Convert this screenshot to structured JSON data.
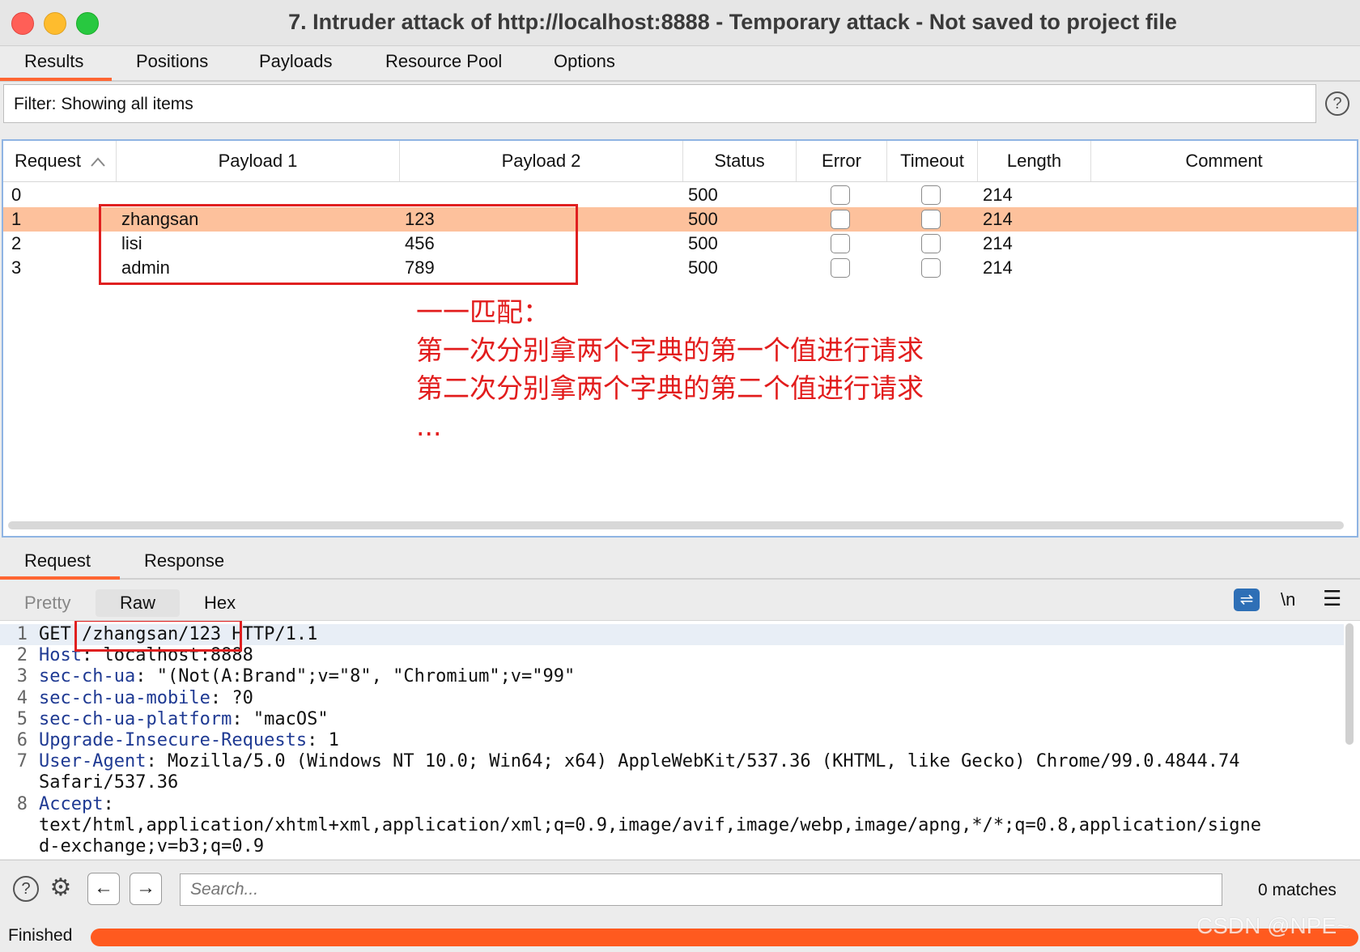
{
  "window": {
    "title": "7. Intruder attack of http://localhost:8888 - Temporary attack - Not saved to project file"
  },
  "tabs": [
    "Results",
    "Positions",
    "Payloads",
    "Resource Pool",
    "Options"
  ],
  "filter": {
    "text": "Filter: Showing all items"
  },
  "table": {
    "headers": [
      "Request",
      "Payload 1",
      "Payload 2",
      "Status",
      "Error",
      "Timeout",
      "Length",
      "Comment"
    ],
    "sort_indicator": "^",
    "rows": [
      {
        "request": "0",
        "payload1": "",
        "payload2": "",
        "status": "500",
        "error": false,
        "timeout": false,
        "length": "214",
        "comment": "",
        "selected": false
      },
      {
        "request": "1",
        "payload1": "zhangsan",
        "payload2": "123",
        "status": "500",
        "error": false,
        "timeout": false,
        "length": "214",
        "comment": "",
        "selected": true
      },
      {
        "request": "2",
        "payload1": "lisi",
        "payload2": "456",
        "status": "500",
        "error": false,
        "timeout": false,
        "length": "214",
        "comment": "",
        "selected": false
      },
      {
        "request": "3",
        "payload1": "admin",
        "payload2": "789",
        "status": "500",
        "error": false,
        "timeout": false,
        "length": "214",
        "comment": "",
        "selected": false
      }
    ]
  },
  "annotation": {
    "lines": [
      "一一匹配：",
      "第一次分别拿两个字典的第一个值进行请求",
      "第二次分别拿两个字典的第二个值进行请求",
      "..."
    ],
    "color": "#e21c1c"
  },
  "message_tabs": [
    "Request",
    "Response"
  ],
  "view_tabs": [
    "Pretty",
    "Raw",
    "Hex"
  ],
  "view_icons": {
    "wrap": "wrap-lines-icon",
    "newline": "\\n",
    "menu": "hamburger-menu-icon"
  },
  "request_lines": [
    {
      "n": "1",
      "key": "",
      "sep": "",
      "value": "GET /zhangsan/123 HTTP/1.1"
    },
    {
      "n": "2",
      "key": "Host",
      "sep": ": ",
      "value": "localhost:8888"
    },
    {
      "n": "3",
      "key": "sec-ch-ua",
      "sep": ": ",
      "value": "\"(Not(A:Brand\";v=\"8\", \"Chromium\";v=\"99\""
    },
    {
      "n": "4",
      "key": "sec-ch-ua-mobile",
      "sep": ": ",
      "value": "?0"
    },
    {
      "n": "5",
      "key": "sec-ch-ua-platform",
      "sep": ": ",
      "value": "\"macOS\""
    },
    {
      "n": "6",
      "key": "Upgrade-Insecure-Requests",
      "sep": ": ",
      "value": "1"
    },
    {
      "n": "7",
      "key": "User-Agent",
      "sep": ": ",
      "value": "Mozilla/5.0 (Windows NT 10.0; Win64; x64) AppleWebKit/537.36 (KHTML, like Gecko) Chrome/99.0.4844.74"
    },
    {
      "n": "",
      "key": "",
      "sep": "",
      "value": "Safari/537.36"
    },
    {
      "n": "8",
      "key": "Accept",
      "sep": ":",
      "value": ""
    },
    {
      "n": "",
      "key": "",
      "sep": "",
      "value": "text/html,application/xhtml+xml,application/xml;q=0.9,image/avif,image/webp,image/apng,*/*;q=0.8,application/signe"
    },
    {
      "n": "",
      "key": "",
      "sep": "",
      "value": "d-exchange;v=b3;q=0.9"
    }
  ],
  "search": {
    "placeholder": "Search...",
    "matches": "0 matches"
  },
  "status": {
    "text": "Finished",
    "progress": 1.0
  },
  "watermark": "CSDN @NPE~"
}
